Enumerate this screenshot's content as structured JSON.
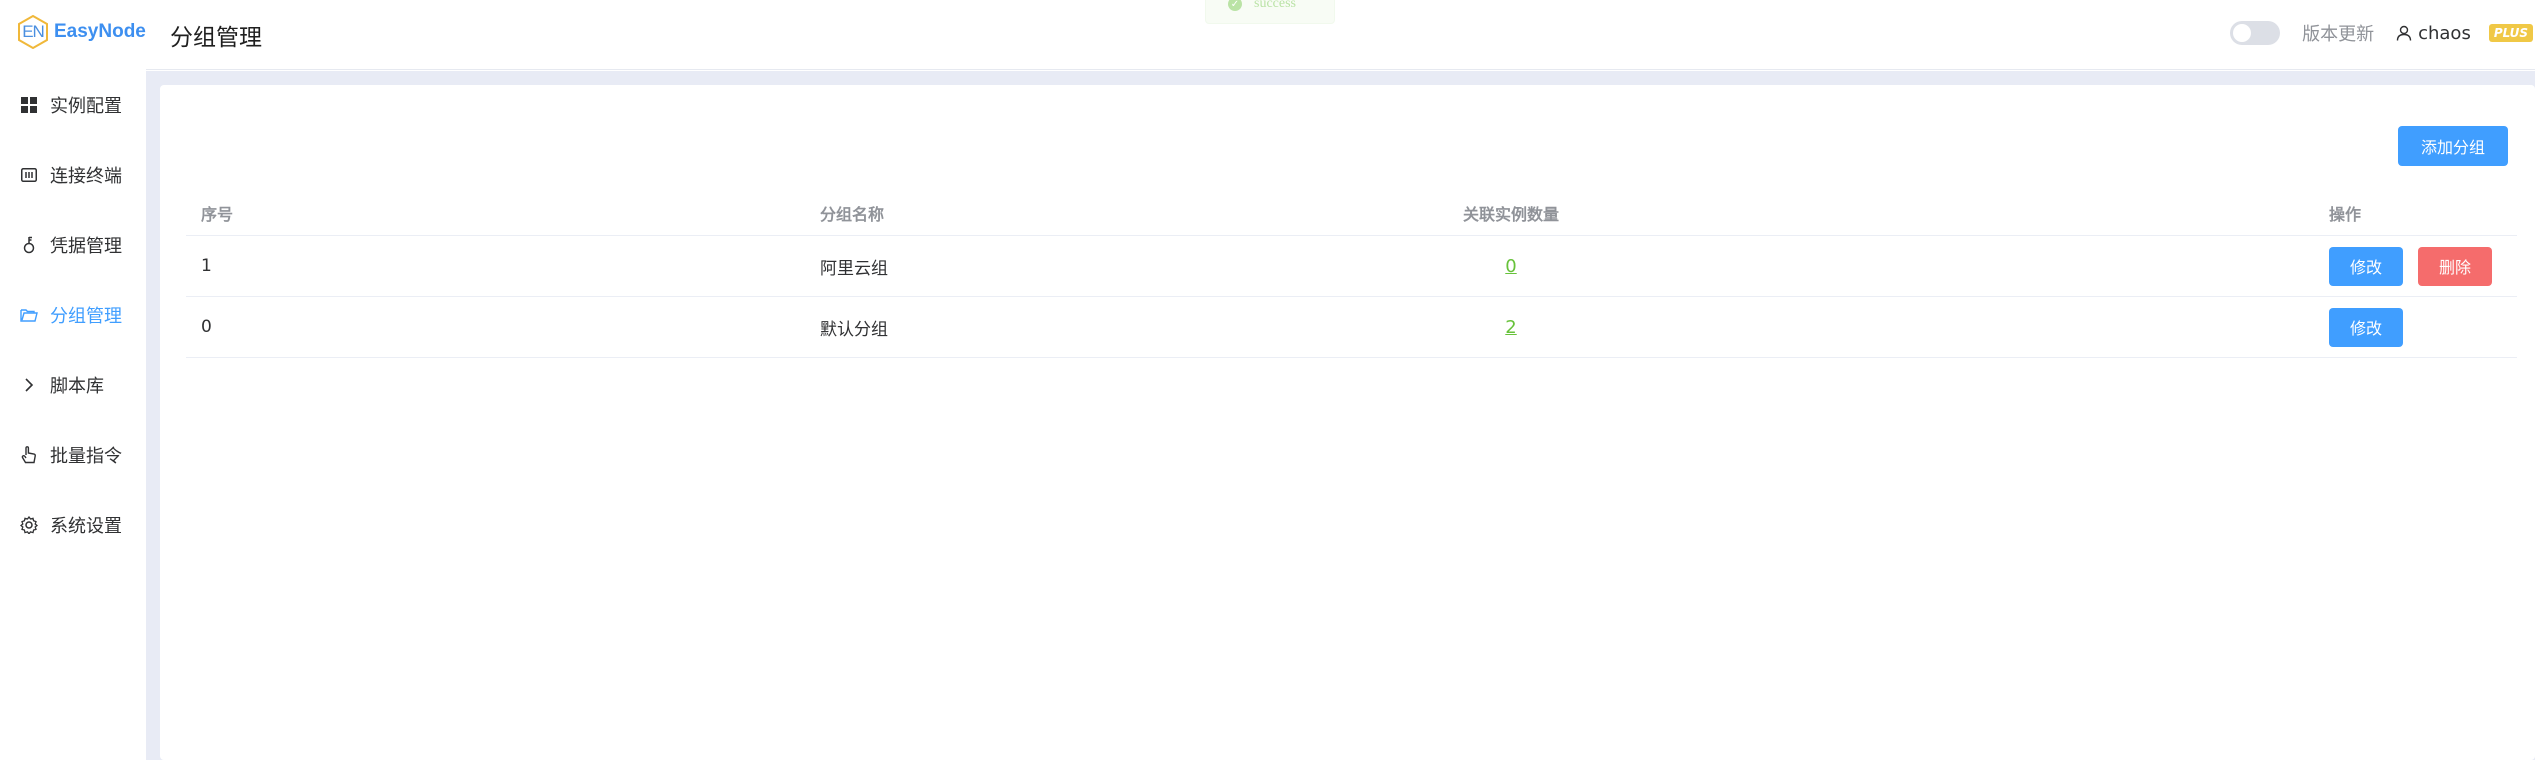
{
  "app": {
    "logo_badge": "EN",
    "name": "EasyNode"
  },
  "sidebar": {
    "items": [
      {
        "label": "实例配置",
        "icon": "grid-icon",
        "active": false
      },
      {
        "label": "连接终端",
        "icon": "terminal-icon",
        "active": false
      },
      {
        "label": "凭据管理",
        "icon": "key-icon",
        "active": false
      },
      {
        "label": "分组管理",
        "icon": "folder-icon",
        "active": true
      },
      {
        "label": "脚本库",
        "icon": "chevron-right-icon",
        "active": false
      },
      {
        "label": "批量指令",
        "icon": "pointer-icon",
        "active": false
      },
      {
        "label": "系统设置",
        "icon": "gear-icon",
        "active": false
      }
    ]
  },
  "header": {
    "title": "分组管理",
    "toast": "success",
    "theme_switch_text": "",
    "update_link": "版本更新",
    "username": "chaos",
    "plan_badge": "PLUS"
  },
  "main": {
    "add_button": "添加分组",
    "table": {
      "columns": [
        "序号",
        "分组名称",
        "关联实例数量",
        "操作"
      ],
      "rows": [
        {
          "index": "1",
          "name": "阿里云组",
          "count": "0",
          "actions": [
            "修改",
            "删除"
          ]
        },
        {
          "index": "0",
          "name": "默认分组",
          "count": "2",
          "actions": [
            "修改"
          ]
        }
      ]
    }
  },
  "colors": {
    "primary": "#409eff",
    "danger": "#f56c6c",
    "success": "#67c23a",
    "plus_badge": "#f0c846",
    "main_bg": "#e8ebf5"
  }
}
